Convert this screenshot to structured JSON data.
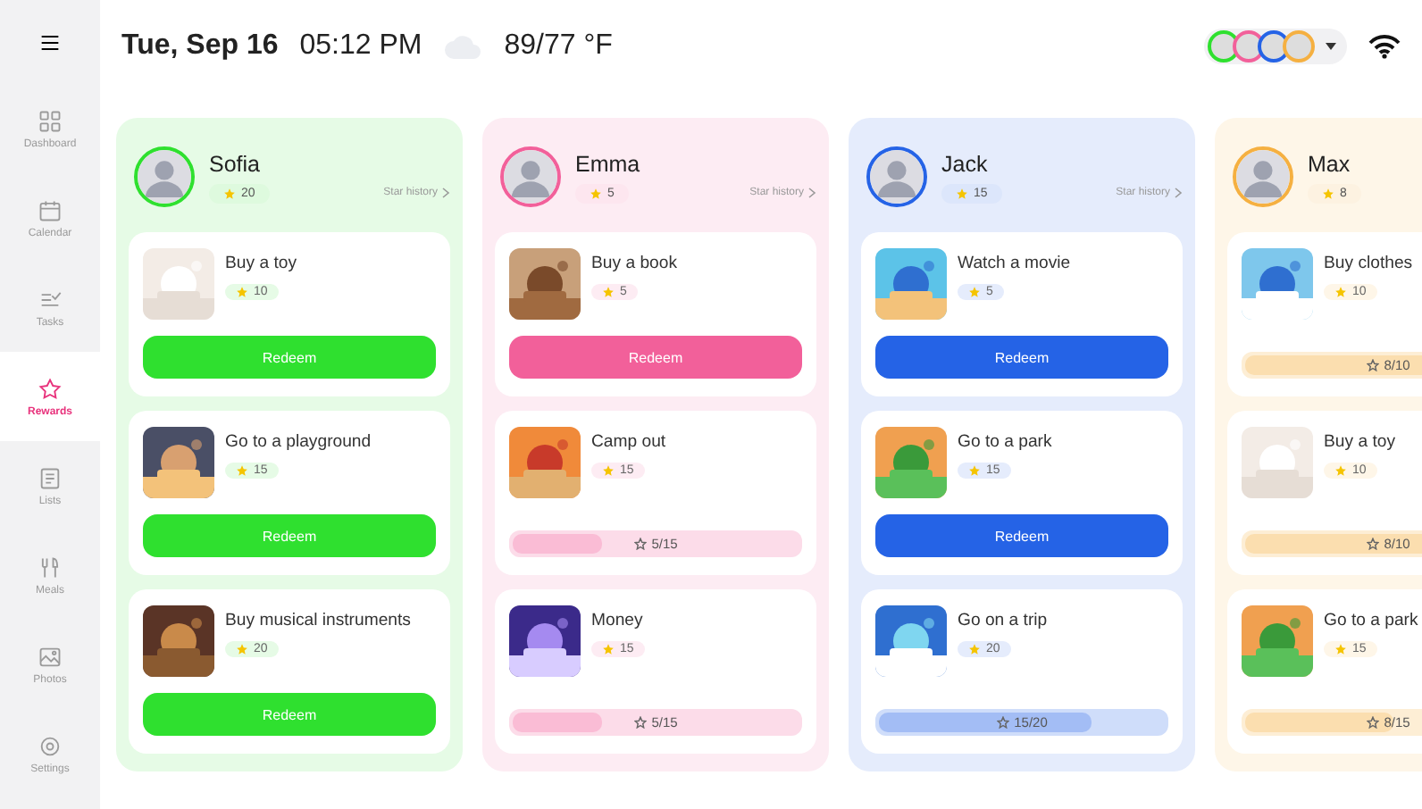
{
  "sidebar": {
    "items": [
      {
        "label": "Dashboard",
        "selected": false
      },
      {
        "label": "Calendar",
        "selected": false
      },
      {
        "label": "Tasks",
        "selected": false
      },
      {
        "label": "Rewards",
        "selected": true
      },
      {
        "label": "Lists",
        "selected": false
      },
      {
        "label": "Meals",
        "selected": false
      },
      {
        "label": "Photos",
        "selected": false
      },
      {
        "label": "Settings",
        "selected": false
      }
    ]
  },
  "header": {
    "date": "Tue, Sep 16",
    "time": "05:12 PM",
    "temperature": "89/77 °F"
  },
  "members": [
    {
      "name": "Sofia",
      "color": "#2fe02f",
      "star_count": "20",
      "star_history": "Star history",
      "rewards": [
        {
          "title": "Buy a toy",
          "cost": "10",
          "kind": "redeem",
          "button": "Redeem"
        },
        {
          "title": "Go to a playground",
          "cost": "15",
          "kind": "redeem",
          "button": "Redeem"
        },
        {
          "title": "Buy musical instruments",
          "cost": "20",
          "kind": "redeem",
          "button": "Redeem"
        }
      ]
    },
    {
      "name": "Emma",
      "color": "#f2609a",
      "star_count": "5",
      "star_history": "Star history",
      "rewards": [
        {
          "title": "Buy a book",
          "cost": "5",
          "kind": "redeem",
          "button": "Redeem"
        },
        {
          "title": "Camp out",
          "cost": "15",
          "kind": "progress",
          "progress": "5/15",
          "level": 0.33
        },
        {
          "title": "Money",
          "cost": "15",
          "kind": "progress",
          "progress": "5/15",
          "level": 0.33
        }
      ]
    },
    {
      "name": "Jack",
      "color": "#2563e6",
      "star_count": "15",
      "star_history": "Star history",
      "rewards": [
        {
          "title": "Watch a movie",
          "cost": "5",
          "kind": "redeem",
          "button": "Redeem"
        },
        {
          "title": "Go to a park",
          "cost": "15",
          "kind": "redeem",
          "button": "Redeem"
        },
        {
          "title": "Go on a trip",
          "cost": "20",
          "kind": "progress",
          "progress": "15/20",
          "level": 0.75
        }
      ]
    },
    {
      "name": "Max",
      "color": "#f5b041",
      "star_count": "8",
      "rewards": [
        {
          "title": "Buy clothes",
          "cost": "10",
          "kind": "progress",
          "progress": "8/10",
          "level": 0.8
        },
        {
          "title": "Buy a toy",
          "cost": "10",
          "kind": "progress",
          "progress": "8/10",
          "level": 0.8
        },
        {
          "title": "Go to a park",
          "cost": "15",
          "kind": "progress",
          "progress": "8/15",
          "level": 0.53
        }
      ]
    }
  ]
}
